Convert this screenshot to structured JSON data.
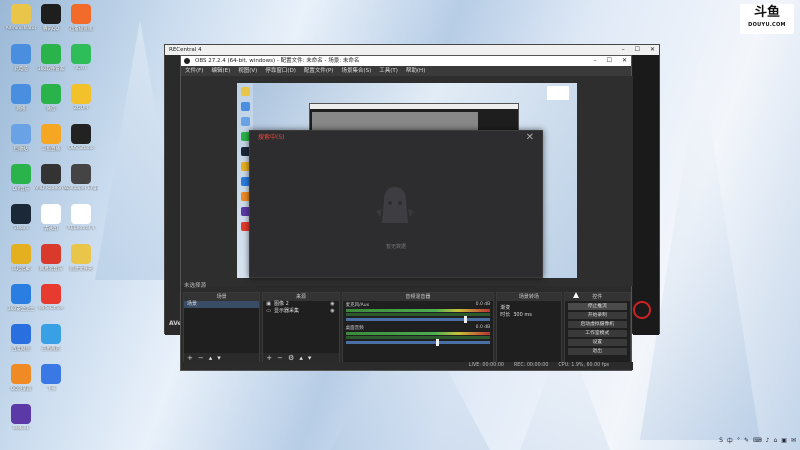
{
  "desktop": {
    "icons_col1": [
      {
        "label": "Administrator",
        "icon": "user-folder-icon",
        "color": "#e9c54a"
      },
      {
        "label": "此电脑",
        "icon": "computer-icon",
        "color": "#4a8ee0"
      },
      {
        "label": "网络",
        "icon": "network-icon",
        "color": "#4a8ee0"
      },
      {
        "label": "回收站",
        "icon": "recycle-bin-icon",
        "color": "#6aa2e6"
      },
      {
        "label": "DIY音乐",
        "icon": "music-icon",
        "color": "#2ab34a"
      },
      {
        "label": "Steam",
        "icon": "steam-icon",
        "color": "#1b2838"
      },
      {
        "label": "风起云聚",
        "icon": "game-icon",
        "color": "#e4b020"
      },
      {
        "label": "360安全卫士",
        "icon": "shield-icon",
        "color": "#2a7de1"
      },
      {
        "label": "百度网盘",
        "icon": "cloud-icon",
        "color": "#2a6fe0"
      },
      {
        "label": "QQ浏览器",
        "icon": "browser-icon",
        "color": "#f08a24"
      },
      {
        "label": "WeLink",
        "icon": "welink-icon",
        "color": "#5b3aa8"
      }
    ],
    "icons_col2": [
      {
        "label": "腾讯QQ",
        "icon": "qq-icon",
        "color": "#1e1e1e"
      },
      {
        "label": "360软件管家",
        "icon": "apps-icon",
        "color": "#2ab34a"
      },
      {
        "label": "微信",
        "icon": "wechat-icon",
        "color": "#2ab34a"
      },
      {
        "label": "斗鱼直播",
        "icon": "douyu-icon",
        "color": "#f5a623"
      },
      {
        "label": "AMD Radeon Software",
        "icon": "amd-icon",
        "color": "#333333"
      },
      {
        "label": "去水印",
        "icon": "text-icon",
        "color": "#ffffff"
      },
      {
        "label": "网易云音乐",
        "icon": "netease-icon",
        "color": "#d93a2b"
      },
      {
        "label": "WPS Office",
        "icon": "wps-icon",
        "color": "#e63b2e"
      },
      {
        "label": "应用商店",
        "icon": "store-icon",
        "color": "#3aa0e6"
      },
      {
        "label": "飞书",
        "icon": "feishu-icon",
        "color": "#3a78e6"
      }
    ],
    "icons_col3": [
      {
        "label": "迅雷极速版",
        "icon": "thunder-icon",
        "color": "#f26b2a"
      },
      {
        "label": "iQIYI",
        "icon": "iqiyi-icon",
        "color": "#2ebd59"
      },
      {
        "label": "ZOOM",
        "icon": "owl-icon",
        "color": "#f3c12a"
      },
      {
        "label": "OBS Studio",
        "icon": "obs-icon",
        "color": "#222222"
      },
      {
        "label": "Wallpaper Engine",
        "icon": "wallpaper-icon",
        "color": "#444444"
      },
      {
        "label": "RECentral 4",
        "icon": "recentral-icon",
        "color": "#ffffff"
      },
      {
        "label": "新建文件夹",
        "icon": "folder-icon",
        "color": "#e9c54a"
      }
    ]
  },
  "douyu": {
    "mark": "斗鱼",
    "site": "DOUYU.COM"
  },
  "recentral": {
    "title": "RECentral 4",
    "logo": "AVe"
  },
  "obs": {
    "title": "OBS 27.2.4 (64-bit, windows) - 配置文件: 未命名 - 场景: 未命名",
    "menu": [
      "文件(F)",
      "编辑(E)",
      "视图(V)",
      "停靠窗口(D)",
      "配置文件(P)",
      "场景集合(S)",
      "工具(T)",
      "帮助(H)"
    ],
    "scene_label": "未选择源",
    "dialog": {
      "title": "搜索中(S)",
      "empty": "暂无数据"
    },
    "docks": {
      "scenes": {
        "header": "场景",
        "items": [
          "场景"
        ]
      },
      "sources": {
        "header": "来源",
        "items": [
          "图像 2",
          "显示器采集"
        ]
      },
      "mixer": {
        "header": "音频混音器",
        "items": [
          {
            "name": "麦克风/Aux",
            "db": "0.0 dB"
          },
          {
            "name": "桌面音频",
            "db": "0.0 dB"
          }
        ]
      },
      "transitions": {
        "header": "场景转场",
        "type": "渐变",
        "duration_label": "时长",
        "duration": "300 ms"
      },
      "controls": {
        "header": "控件",
        "buttons": [
          "停止推流",
          "开始录制",
          "启动虚拟摄像机",
          "工作室模式",
          "设置",
          "退出"
        ]
      }
    },
    "status": {
      "live": "LIVE: 00:00:00",
      "rec": "REC: 00:00:00",
      "cpu": "CPU: 1.9%, 60.00 fps"
    }
  },
  "tray": {
    "items": [
      "S",
      "中",
      "°",
      "✎",
      "⌨",
      "♪",
      "⌂",
      "▣",
      "✉"
    ]
  }
}
